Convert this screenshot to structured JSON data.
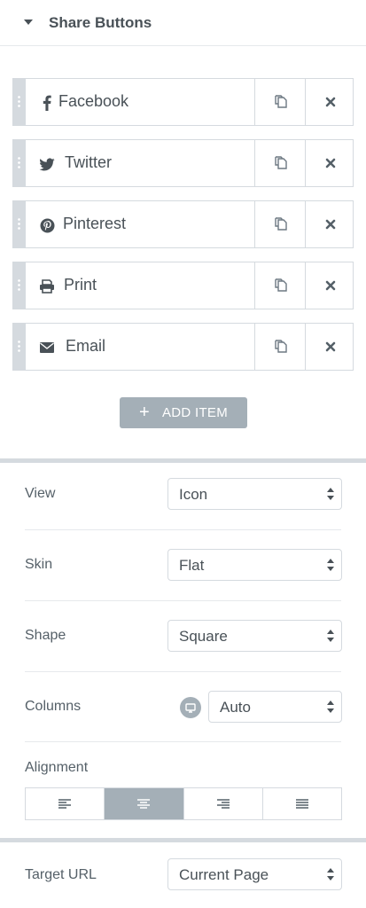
{
  "section": {
    "title": "Share Buttons"
  },
  "items": [
    {
      "label": "Facebook",
      "icon": "facebook-icon"
    },
    {
      "label": "Twitter",
      "icon": "twitter-icon"
    },
    {
      "label": "Pinterest",
      "icon": "pinterest-icon"
    },
    {
      "label": "Print",
      "icon": "print-icon"
    },
    {
      "label": "Email",
      "icon": "envelope-icon"
    }
  ],
  "add_item": {
    "label": "ADD ITEM"
  },
  "controls": {
    "view": {
      "label": "View",
      "value": "Icon"
    },
    "skin": {
      "label": "Skin",
      "value": "Flat"
    },
    "shape": {
      "label": "Shape",
      "value": "Square"
    },
    "columns": {
      "label": "Columns",
      "value": "Auto"
    },
    "alignment": {
      "label": "Alignment",
      "options": [
        "left",
        "center",
        "right",
        "justify"
      ],
      "selected": "center"
    },
    "target_url": {
      "label": "Target URL",
      "value": "Current Page"
    }
  },
  "colors": {
    "accent": "#a4afb7",
    "border": "#d5dadf",
    "text": "#495157"
  }
}
